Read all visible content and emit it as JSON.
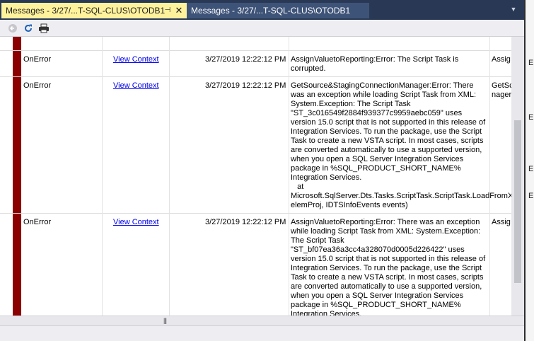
{
  "tabs": [
    {
      "label": "Messages - 3/27/...T-SQL-CLUS\\OTODB1",
      "active": true
    },
    {
      "label": "Messages - 3/27/...T-SQL-CLUS\\OTODB1",
      "active": false
    }
  ],
  "tab_pin_glyph": "⊣",
  "tab_close_glyph": "✕",
  "toolbar": {
    "icons": [
      "back-arrow-icon",
      "refresh-icon",
      "print-icon"
    ]
  },
  "rows": [
    {
      "event": "OnError",
      "link": "View Context",
      "time": "3/27/2019 12:22:12 PM",
      "message": "AssignValuetoReporting:Error: The Script Task is corrupted.",
      "extra": "Assig"
    },
    {
      "event": "OnError",
      "link": "View Context",
      "time": "3/27/2019 12:22:12 PM",
      "message": "GetSource&StagingConnectionManager:Error: There was an exception while loading Script Task from XML: System.Exception: The Script Task \"ST_3c016549f2884f939377c9959aebc059\" uses version 15.0 script that is not supported in this release of Integration Services. To run the package, use the Script Task to create a new VSTA script. In most cases, scripts are converted automatically to use a supported version, when you open a SQL Server Integration Services package in %SQL_PRODUCT_SHORT_NAME% Integration Services.\n   at Microsoft.SqlServer.Dts.Tasks.ScriptTask.ScriptTask.LoadFromXML(XmlElement elemProj, IDTSInfoEvents events)",
      "extra": "GetSc nager"
    },
    {
      "event": "OnError",
      "link": "View Context",
      "time": "3/27/2019 12:22:12 PM",
      "message": "AssignValuetoReporting:Error: There was an exception while loading Script Task from XML: System.Exception: The Script Task \"ST_bf07ea36a3cc4a328070d0005d226422\" uses version 15.0 script that is not supported in this release of Integration Services. To run the package, use the Script Task to create a new VSTA script. In most cases, scripts are converted automatically to use a supported version, when you open a SQL Server Integration Services package in %SQL_PRODUCT_SHORT_NAME% Integration Services.",
      "extra": "Assig"
    }
  ],
  "right_panel_letters": [
    "E",
    "E",
    "E",
    "E"
  ],
  "splitter_grip": "|||",
  "colors": {
    "error_bar": "#8b0000",
    "active_tab": "#fff29d",
    "tab_strip": "#293955",
    "link": "#0000ee"
  }
}
